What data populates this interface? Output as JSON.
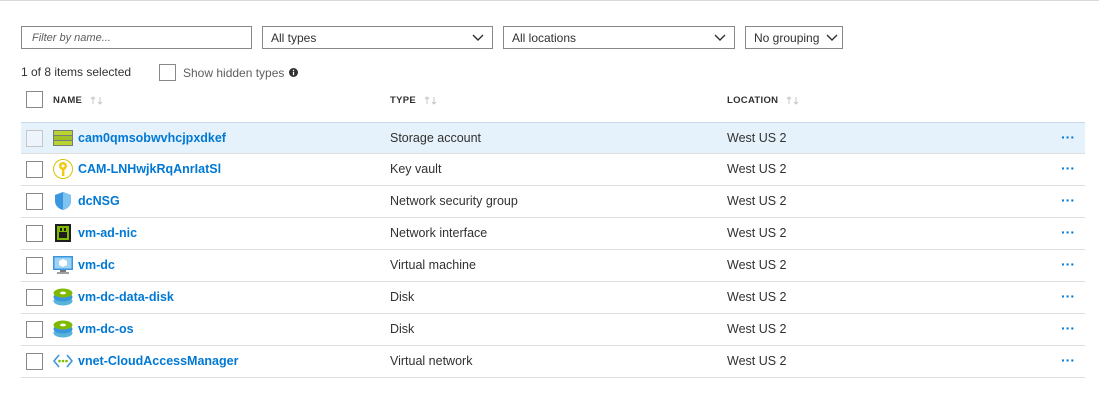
{
  "filters": {
    "name_placeholder": "Filter by name...",
    "types_value": "All types",
    "locations_value": "All locations",
    "grouping_value": "No grouping"
  },
  "summary": {
    "selected_text": "1 of 8 items selected",
    "show_hidden_label": "Show hidden types"
  },
  "columns": {
    "name": "NAME",
    "type": "TYPE",
    "location": "LOCATION"
  },
  "rows": [
    {
      "name": "cam0qmsobwvhcjpxdkef",
      "type": "Storage account",
      "location": "West US 2",
      "icon": "storage-account-icon",
      "selected": true
    },
    {
      "name": "CAM-LNHwjkRqAnrIatSl",
      "type": "Key vault",
      "location": "West US 2",
      "icon": "key-vault-icon",
      "selected": false
    },
    {
      "name": "dcNSG",
      "type": "Network security group",
      "location": "West US 2",
      "icon": "network-security-group-icon",
      "selected": false
    },
    {
      "name": "vm-ad-nic",
      "type": "Network interface",
      "location": "West US 2",
      "icon": "network-interface-icon",
      "selected": false
    },
    {
      "name": "vm-dc",
      "type": "Virtual machine",
      "location": "West US 2",
      "icon": "virtual-machine-icon",
      "selected": false
    },
    {
      "name": "vm-dc-data-disk",
      "type": "Disk",
      "location": "West US 2",
      "icon": "disk-icon",
      "selected": false
    },
    {
      "name": "vm-dc-os",
      "type": "Disk",
      "location": "West US 2",
      "icon": "disk-icon",
      "selected": false
    },
    {
      "name": "vnet-CloudAccessManager",
      "type": "Virtual network",
      "location": "West US 2",
      "icon": "virtual-network-icon",
      "selected": false
    }
  ],
  "more_label": "···",
  "colors": {
    "accent": "#0078d4",
    "selected_row": "#e6f2fb",
    "border": "#8a8886"
  }
}
